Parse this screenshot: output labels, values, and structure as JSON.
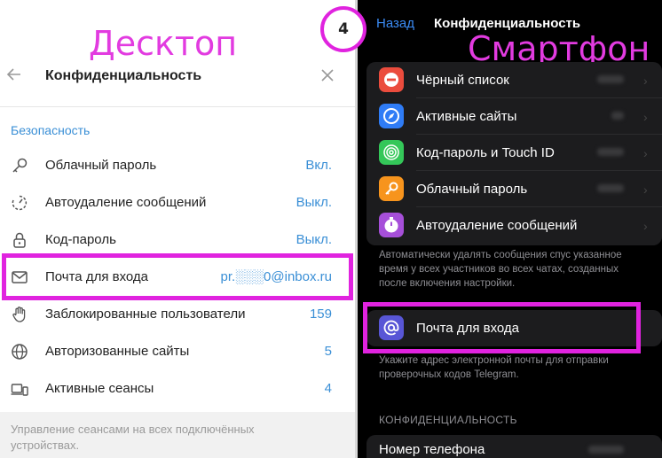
{
  "desktop": {
    "label": "Десктоп",
    "title": "Конфиденциальность",
    "section": "Безопасность",
    "rows": [
      {
        "label": "Облачный пароль",
        "value": "Вкл."
      },
      {
        "label": "Автоудаление сообщений",
        "value": "Выкл."
      },
      {
        "label": "Код-пароль",
        "value": "Выкл."
      },
      {
        "label": "Почта для входа",
        "value": "pr.░░░0@inbox.ru"
      },
      {
        "label": "Заблокированные пользователи",
        "value": "159"
      },
      {
        "label": "Авторизованные сайты",
        "value": "5"
      },
      {
        "label": "Активные сеансы",
        "value": "4"
      }
    ],
    "footer": "Управление сеансами на всех подключённых устройствах."
  },
  "step": "4",
  "phone": {
    "label": "Смартфон",
    "back": "Назад",
    "title": "Конфиденциальность",
    "rows": [
      {
        "label": "Чёрный список",
        "icon": "minus-icon",
        "color": "#eb4c3d"
      },
      {
        "label": "Активные сайты",
        "icon": "compass-icon",
        "color": "#2f7cf6"
      },
      {
        "label": "Код-пароль и Touch ID",
        "icon": "fingerprint-icon",
        "color": "#34c759"
      },
      {
        "label": "Облачный пароль",
        "icon": "key-icon",
        "color": "#f7941d"
      },
      {
        "label": "Автоудаление сообщений",
        "icon": "timer-icon",
        "color": "#a64fd9"
      }
    ],
    "autodelete_note": "Автоматически удалять сообщения спус указанное время у всех участников во всех чатах, созданных после включения настройки.",
    "email_row": {
      "label": "Почта для входа",
      "icon": "at-icon",
      "color": "#5856d6"
    },
    "email_note": "Укажите адрес электронной почты для отправки проверочных кодов Telegram.",
    "section": "КОНФИДЕНЦИАЛЬНОСТЬ",
    "phone_row": "Номер телефона"
  },
  "colors": {
    "highlight": "#e023df",
    "accent_link": "#3a8fd6",
    "ios_blue": "#3b8bf4"
  }
}
